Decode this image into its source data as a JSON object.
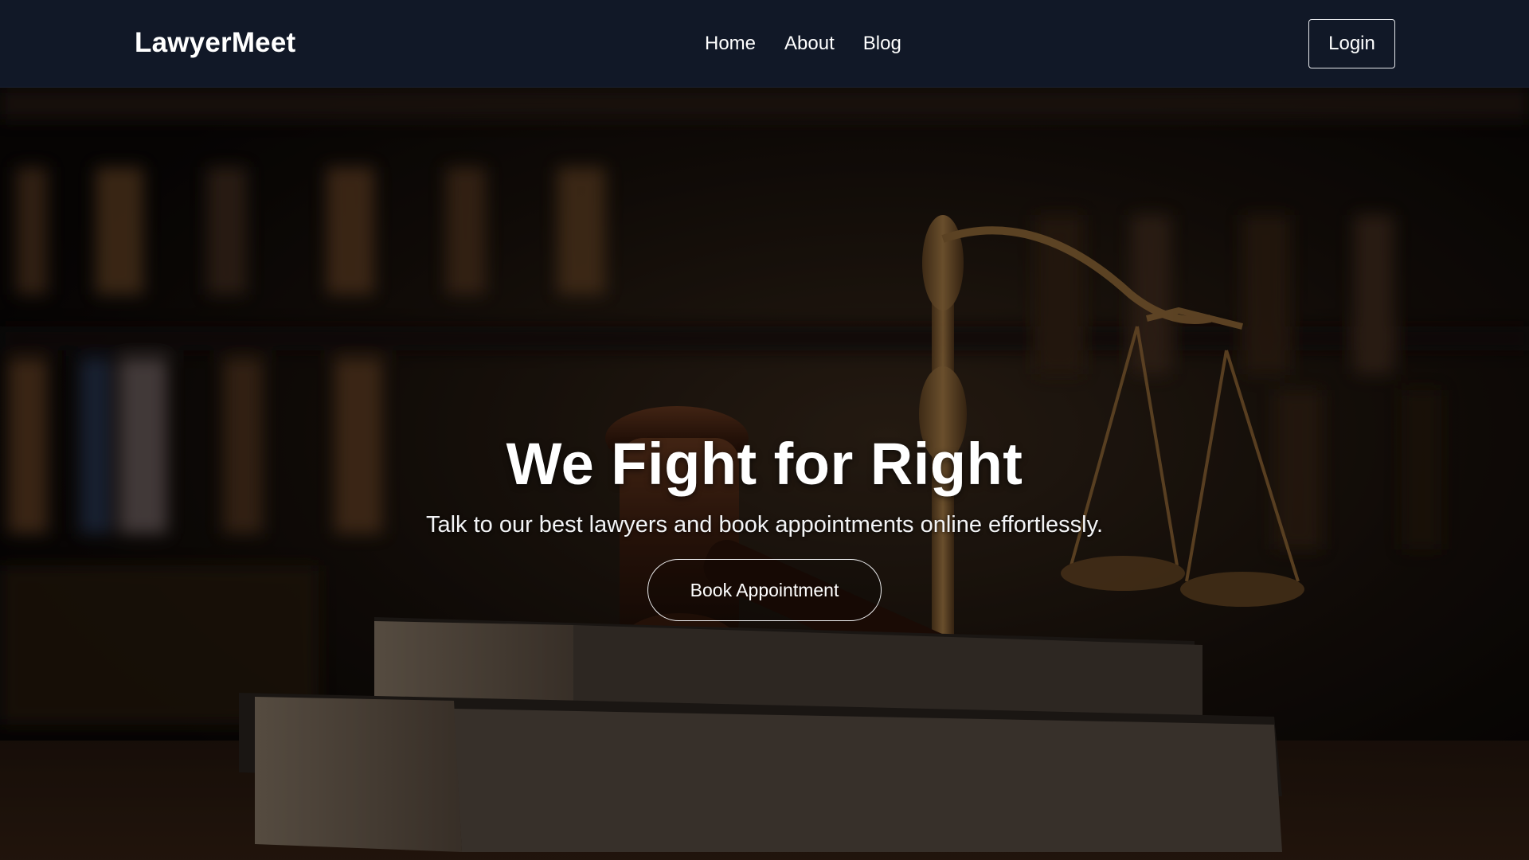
{
  "colors": {
    "navbar_bg": "#111827",
    "text": "#ffffff",
    "button_border": "#e5e7eb"
  },
  "navbar": {
    "brand": "LawyerMeet",
    "links": [
      {
        "label": "Home"
      },
      {
        "label": "About"
      },
      {
        "label": "Blog"
      }
    ],
    "login_label": "Login"
  },
  "hero": {
    "background_image": "gavel-books-scales-icon",
    "title": "We Fight for Right",
    "subtitle": "Talk to our best lawyers and book appointments online effortlessly.",
    "cta_label": "Book Appointment"
  }
}
